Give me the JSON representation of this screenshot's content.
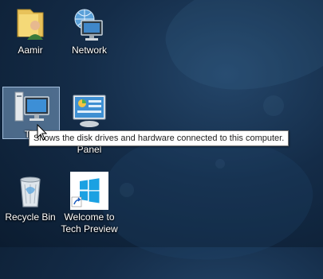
{
  "desktop": {
    "icons": [
      {
        "label": "Aamir",
        "icon": "user-folder-icon"
      },
      {
        "label": "Network",
        "icon": "network-icon"
      },
      {
        "label": "This PC",
        "icon": "this-pc-icon"
      },
      {
        "label": "Control Panel",
        "icon": "control-panel-icon"
      },
      {
        "label": "Recycle Bin",
        "icon": "recycle-bin-icon"
      },
      {
        "label": "Welcome to Tech Preview",
        "icon": "welcome-windows-icon"
      }
    ],
    "visible_labels": {
      "this_pc_partial": "Thi",
      "control_panel_partial": "Panel",
      "welcome_line1": "Welcome to",
      "welcome_line2": "Tech Preview"
    }
  },
  "tooltip": {
    "text": "Shows the disk drives and hardware connected to this computer."
  }
}
